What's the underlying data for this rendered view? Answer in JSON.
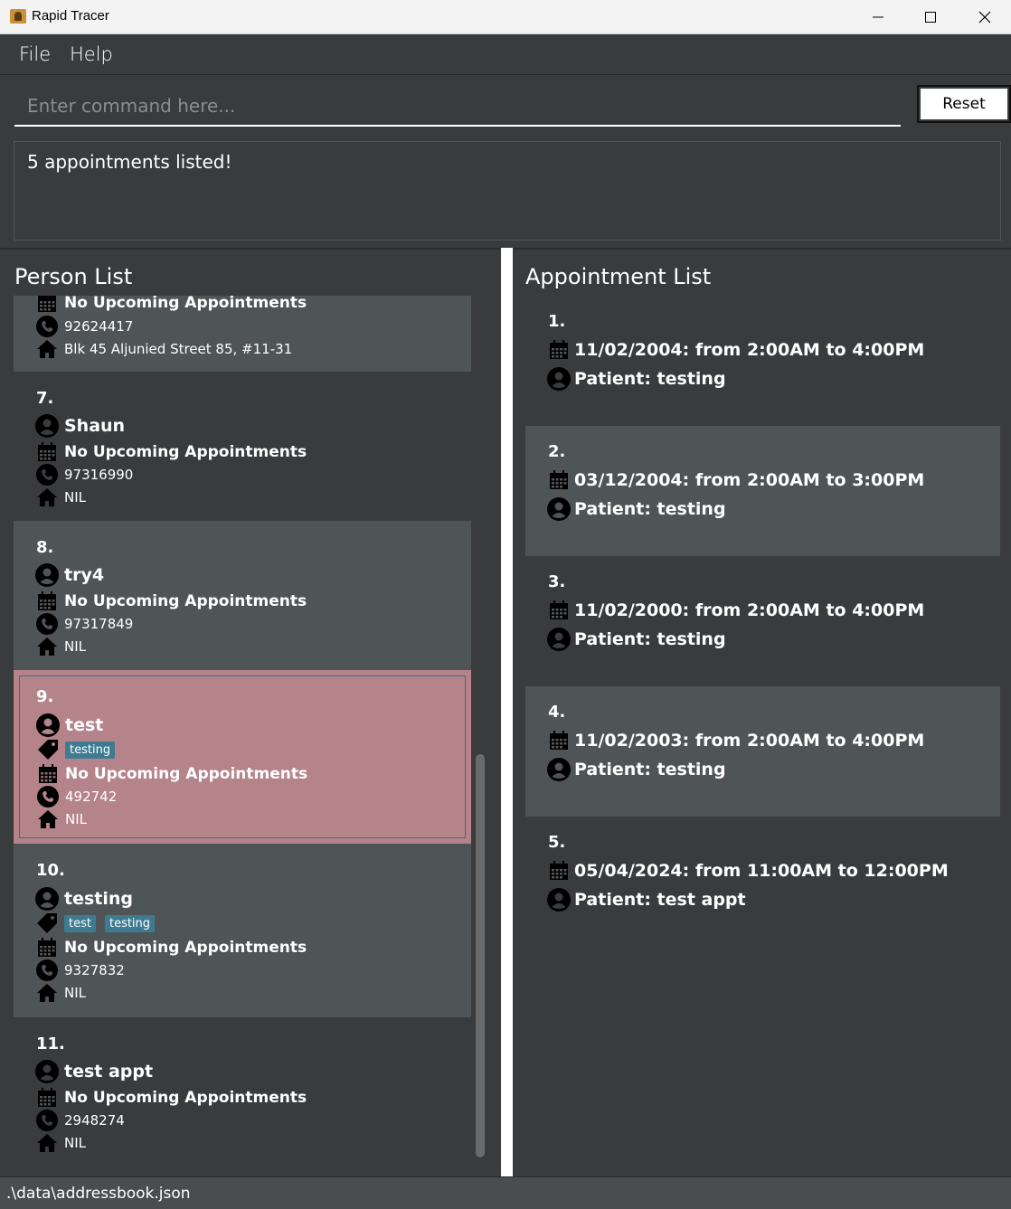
{
  "window": {
    "title": "Rapid Tracer"
  },
  "menu": {
    "file": "File",
    "help": "Help"
  },
  "command": {
    "placeholder": "Enter command here...",
    "reset_label": "Reset"
  },
  "result": {
    "message": "5 appointments listed!"
  },
  "person_list": {
    "title": "Person List",
    "persons": [
      {
        "index": "",
        "name": "",
        "tags": [],
        "appointments": "No Upcoming Appointments",
        "phone": "92624417",
        "address": "Blk 45 Aljunied Street 85, #11-31"
      },
      {
        "index": "7.",
        "name": "Shaun",
        "tags": [],
        "appointments": "No Upcoming Appointments",
        "phone": "97316990",
        "address": "NIL"
      },
      {
        "index": "8.",
        "name": "try4",
        "tags": [],
        "appointments": "No Upcoming Appointments",
        "phone": "97317849",
        "address": "NIL"
      },
      {
        "index": "9.",
        "name": "test",
        "tags": [
          "testing"
        ],
        "appointments": "No Upcoming Appointments",
        "phone": "492742",
        "address": "NIL"
      },
      {
        "index": "10.",
        "name": "testing",
        "tags": [
          "test",
          "testing"
        ],
        "appointments": "No Upcoming Appointments",
        "phone": "9327832",
        "address": "NIL"
      },
      {
        "index": "11.",
        "name": "test appt",
        "tags": [],
        "appointments": "No Upcoming Appointments",
        "phone": "2948274",
        "address": "NIL"
      }
    ]
  },
  "appointment_list": {
    "title": "Appointment List",
    "appointments": [
      {
        "index": "1.",
        "time": "11/02/2004: from 2:00AM to 4:00PM",
        "patient": "Patient: testing"
      },
      {
        "index": "2.",
        "time": "03/12/2004: from 2:00AM to 3:00PM",
        "patient": "Patient: testing"
      },
      {
        "index": "3.",
        "time": "11/02/2000: from 2:00AM to 4:00PM",
        "patient": "Patient: testing"
      },
      {
        "index": "4.",
        "time": "11/02/2003: from 2:00AM to 4:00PM",
        "patient": "Patient: testing"
      },
      {
        "index": "5.",
        "time": "05/04/2024: from 11:00AM to 12:00PM",
        "patient": "Patient: test appt"
      }
    ]
  },
  "status": {
    "path": ".\\data\\addressbook.json"
  },
  "colors": {
    "selected_card": "#b4848a",
    "tag": "#3e7b91",
    "light_card": "#4f5457",
    "dark_bg": "#3a3b3d"
  },
  "icons": [
    "person-icon",
    "calendar-icon",
    "phone-icon",
    "home-icon",
    "tag-icon"
  ]
}
